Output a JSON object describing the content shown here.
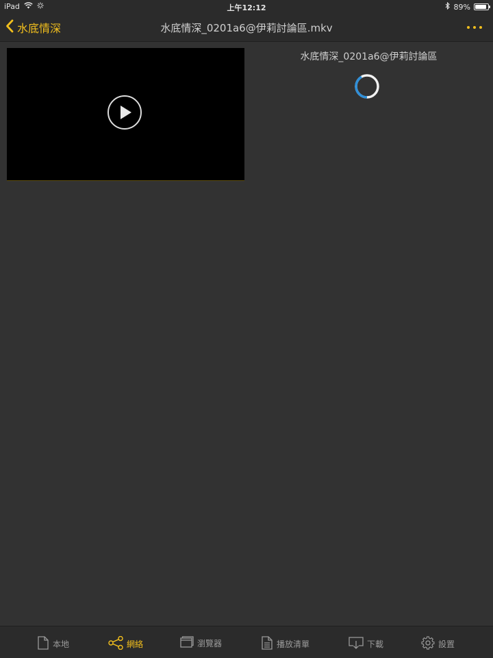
{
  "status_bar": {
    "device": "iPad",
    "time": "上午12:12",
    "battery": "89%",
    "battery_level": 0.89
  },
  "nav": {
    "back_label": "水底情深",
    "title": "水底情深_0201a6@伊莉討論區.mkv"
  },
  "content": {
    "file_name": "水底情深_0201a6@伊莉討論區"
  },
  "tabs": [
    {
      "label": "本地",
      "icon": "document-icon",
      "active": false
    },
    {
      "label": "網絡",
      "icon": "share-icon",
      "active": true
    },
    {
      "label": "瀏覽器",
      "icon": "windows-icon",
      "active": false
    },
    {
      "label": "播放清單",
      "icon": "list-document-icon",
      "active": false
    },
    {
      "label": "下載",
      "icon": "download-icon",
      "active": false
    },
    {
      "label": "設置",
      "icon": "gear-icon",
      "active": false
    }
  ],
  "colors": {
    "accent": "#f2bf1d",
    "background": "#323232",
    "spinner": "#2f8fd8"
  }
}
